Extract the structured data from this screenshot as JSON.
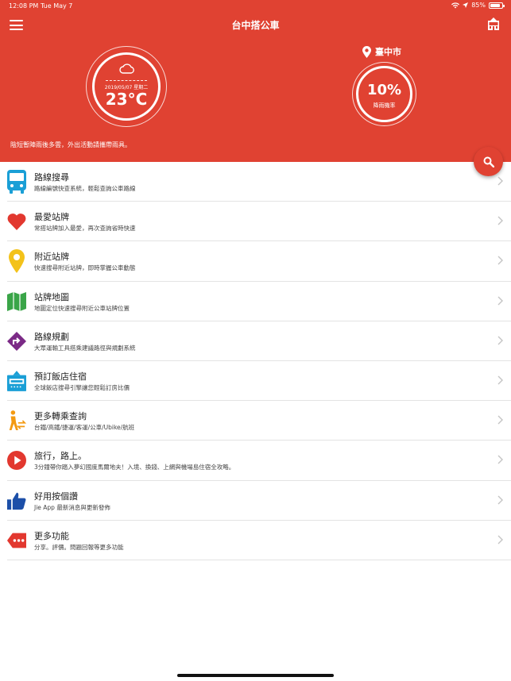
{
  "status_bar": {
    "time": "12:08 PM",
    "date": "Tue May 7",
    "battery": "85%",
    "battery_level": 0.85
  },
  "header": {
    "title": "台中搭公車",
    "weather": {
      "date": "2019/05/07 星期二",
      "temp": "23°C",
      "icon": "cloud-icon"
    },
    "location": "臺中市",
    "rain": {
      "percent": "10%",
      "label": "降雨機率"
    },
    "advisory": "陰短暫陣雨後多雲，外出活動請攜帶雨具。"
  },
  "colors": {
    "brand": "#e04232",
    "divider": "#e3e3e3"
  },
  "menu": [
    {
      "title": "路線搜尋",
      "sub": "路線編號快查系統，輕鬆查詢公車路線",
      "icon": "bus-icon"
    },
    {
      "title": "最愛站牌",
      "sub": "常搭站牌加入最愛，再次查詢省時快速",
      "icon": "heart-icon"
    },
    {
      "title": "附近站牌",
      "sub": "快速搜尋附近站牌，即時掌握公車動態",
      "icon": "location-pin-icon"
    },
    {
      "title": "站牌地圖",
      "sub": "地圖定位快速搜尋附近公車站牌位置",
      "icon": "map-icon"
    },
    {
      "title": "路線規劃",
      "sub": "大眾運輸工具搭乘建議路徑與規劃系統",
      "icon": "directions-icon"
    },
    {
      "title": "預訂飯店住宿",
      "sub": "全球飯店搜尋引擎讓您輕鬆訂房比價",
      "icon": "hotel-icon"
    },
    {
      "title": "更多轉乘查詢",
      "sub": "台鐵/高鐵/捷運/客運/公車/Ubike/航班",
      "icon": "transfer-icon"
    },
    {
      "title": "旅行，路上。",
      "sub": "3分鐘帶你踏入夢幻國度馬爾地夫！入境、換錢、上網與機場島住宿全攻略。",
      "icon": "play-icon"
    },
    {
      "title": "好用按個讚",
      "sub": "Jie App 最新消息與更新發佈",
      "icon": "thumbs-up-icon"
    },
    {
      "title": "更多功能",
      "sub": "分享。評價。問題回報等更多功能",
      "icon": "more-icon"
    }
  ]
}
